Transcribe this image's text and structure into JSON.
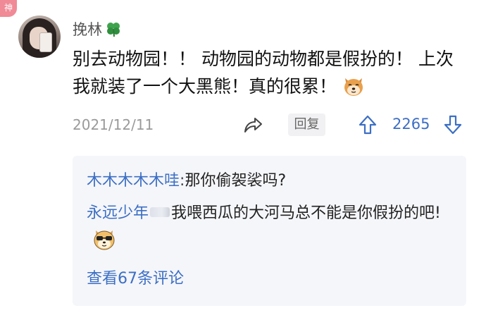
{
  "badge": {
    "text": "神"
  },
  "comment": {
    "username": "挽林",
    "username_icon": "clover-icon",
    "text": "别去动物园！！  动物园的动物都是假扮的！ 上次我就装了一个大黑熊！真的很累！",
    "emoji": "doge-dog-icon",
    "date": "2021/12/11",
    "reply_label": "回复",
    "vote_count": "2265"
  },
  "replies": [
    {
      "user": "木木木木木哇",
      "separator": ":",
      "text": "那你偷袈裟吗?"
    },
    {
      "user": "永远少年",
      "separator": "",
      "text": "我喂西瓜的大河马总不能是你假扮的吧!",
      "emoji": "sunglasses-dog-icon"
    }
  ],
  "view_more": "查看67条评论",
  "colors": {
    "link": "#3c6fc4",
    "badge": "#f08a96",
    "reply_bg": "#f5f6fa"
  }
}
